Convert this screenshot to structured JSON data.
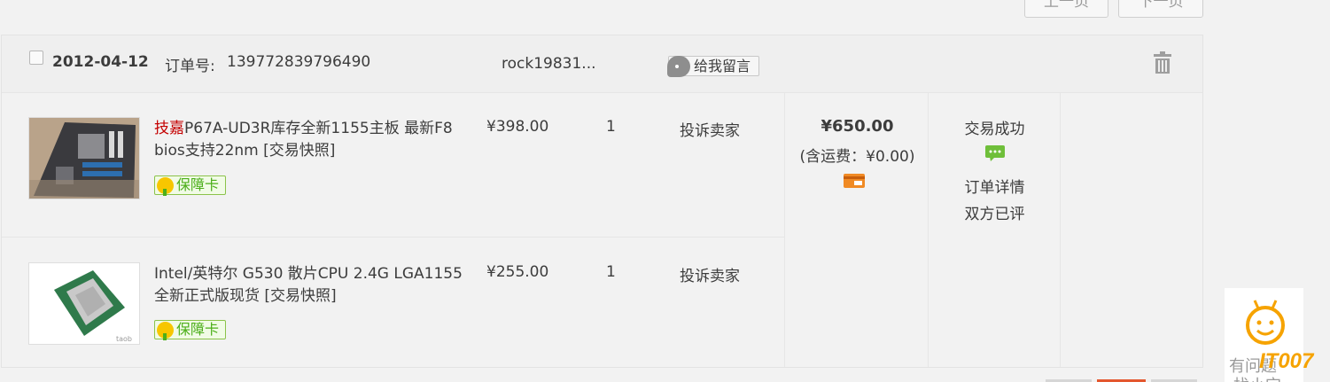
{
  "pagination": {
    "prev_label": "上一页",
    "next_label": "下一页"
  },
  "order": {
    "date": "2012-04-12",
    "order_no_label": "订单号:",
    "order_no": "139772839796490",
    "seller": "rock19831...",
    "message_button": "给我留言",
    "items": [
      {
        "brand": "技嘉",
        "title": "P67A-UD3R库存全新1155主板 最新F8 bios支持22nm [交易快照]",
        "badge": "保障卡",
        "price": "¥398.00",
        "qty": "1",
        "complain": "投诉卖家"
      },
      {
        "brand": "",
        "title": "Intel/英特尔 G530 散片CPU 2.4G LGA1155 全新正式版现货 [交易快照]",
        "badge": "保障卡",
        "price": "¥255.00",
        "qty": "1",
        "complain": "投诉卖家"
      }
    ],
    "total": "¥650.00",
    "shipping": "(含运费：¥0.00)",
    "status": "交易成功",
    "order_detail": "订单详情",
    "rated": "双方已评"
  },
  "widget": {
    "line1": "有问题",
    "line2": "找小宝",
    "brand": "IT007"
  },
  "colors": {
    "accent": "#c40000",
    "badge_green": "#4caf1a",
    "brand_orange": "#f6a300"
  }
}
